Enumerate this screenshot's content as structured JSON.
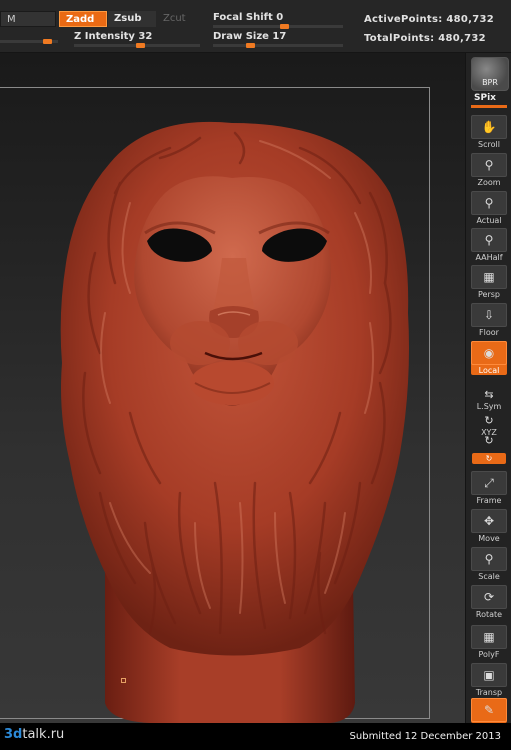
{
  "topbar": {
    "m_label": "M",
    "zadd_label": "Zadd",
    "zsub_label": "Zsub",
    "zcut_label": "Zcut",
    "focal_shift_label": "Focal Shift",
    "focal_shift_value": "0",
    "z_intensity_label": "Z Intensity",
    "z_intensity_value": "32",
    "draw_size_label": "Draw Size",
    "draw_size_value": "17",
    "active_points_label": "ActivePoints:",
    "active_points_value": "480,732",
    "total_points_label": "TotalPoints:",
    "total_points_value": "480,732"
  },
  "shelf": {
    "bpr": "BPR",
    "spix": "SPix",
    "scroll": "Scroll",
    "zoom": "Zoom",
    "actual": "Actual",
    "aahalf": "AAHalf",
    "persp": "Persp",
    "floor": "Floor",
    "local": "Local",
    "lsym": "L.Sym",
    "xyz": "XYZ",
    "frame": "Frame",
    "move": "Move",
    "scale": "Scale",
    "rotate": "Rotate",
    "polyf": "PolyF",
    "transp": "Transp"
  },
  "footer": {
    "logo_prefix": "3d",
    "logo_suffix": "talk.ru",
    "submitted": "Submitted 12 December 2013"
  },
  "colors": {
    "accent": "#e96a17",
    "sculpt": "#b2442c",
    "sculpt_shadow": "#5a1a10",
    "sculpt_highlight": "#d0735a"
  }
}
